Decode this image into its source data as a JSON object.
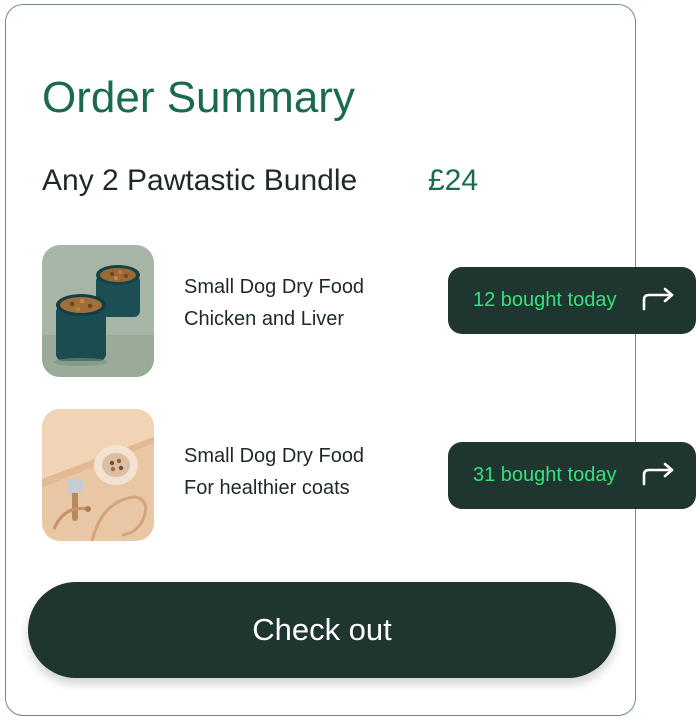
{
  "summary": {
    "title": "Order Summary",
    "bundle_name": "Any 2 Pawtastic Bundle",
    "bundle_price": "£24"
  },
  "items": [
    {
      "line1": "Small Dog Dry Food",
      "line2": "Chicken and Liver",
      "badge": "12 bought today",
      "image": "dog-food-bowls-image"
    },
    {
      "line1": "Small Dog Dry Food",
      "line2": "For healthier coats",
      "badge": "31 bought today",
      "image": "dog-accessories-image"
    }
  ],
  "checkout_label": "Check out",
  "colors": {
    "brand_green": "#1a6b4b",
    "dark_panel": "#1f3530",
    "badge_text": "#35e07e",
    "card_border": "#6f8f82"
  }
}
